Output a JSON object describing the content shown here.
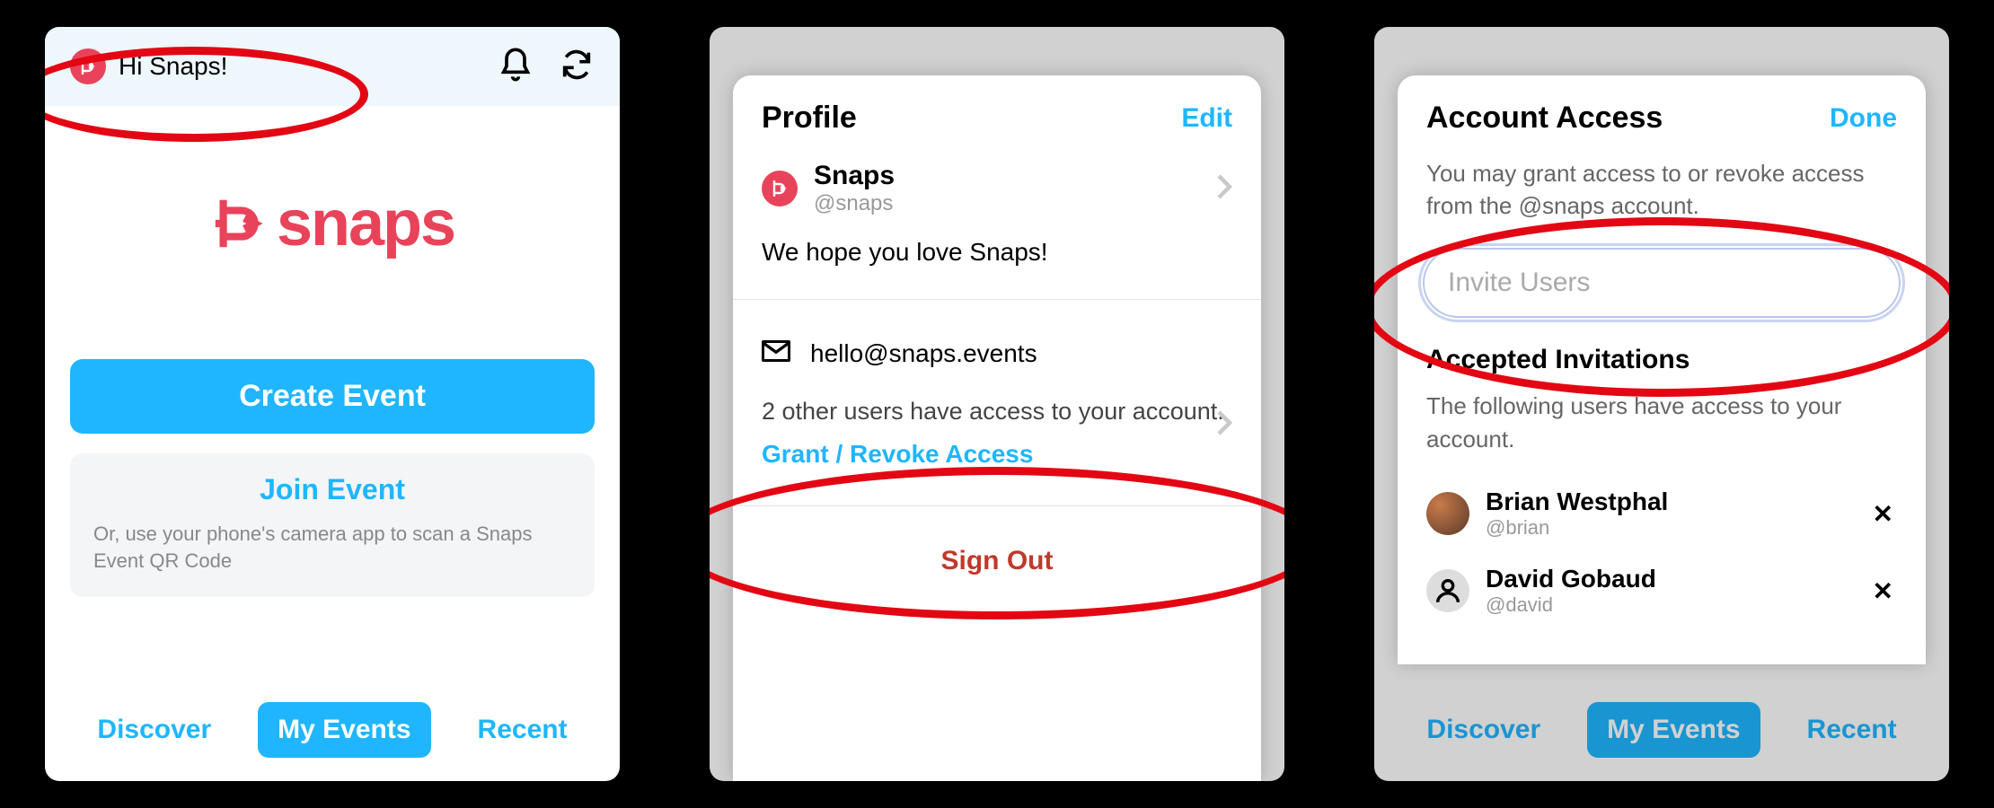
{
  "screen1": {
    "greeting": "Hi Snaps!",
    "brand": "snaps",
    "create_event": "Create Event",
    "join_event": "Join Event",
    "join_event_sub": "Or, use your phone's camera app to scan a Snaps Event QR Code",
    "tabs": {
      "discover": "Discover",
      "my_events": "My Events",
      "recent": "Recent"
    }
  },
  "screen2": {
    "title": "Profile",
    "action": "Edit",
    "name": "Snaps",
    "handle": "@snaps",
    "bio": "We hope you love Snaps!",
    "email": "hello@snaps.events",
    "access_text": "2 other users have access to your account.",
    "access_link": "Grant / Revoke Access",
    "signout": "Sign Out"
  },
  "screen3": {
    "title": "Account Access",
    "action": "Done",
    "sub": "You may grant access to or revoke access from the @snaps account.",
    "invite_placeholder": "Invite Users",
    "section_title": "Accepted Invitations",
    "section_sub": "The following users have access to your account.",
    "users": [
      {
        "name": "Brian Westphal",
        "handle": "@brian"
      },
      {
        "name": "David Gobaud",
        "handle": "@david"
      }
    ],
    "tabs": {
      "discover": "Discover",
      "my_events": "My Events",
      "recent": "Recent"
    }
  },
  "colors": {
    "accent": "#1fb6ff",
    "brand": "#e8435a",
    "danger": "#c0392b",
    "anno": "#e30613"
  }
}
